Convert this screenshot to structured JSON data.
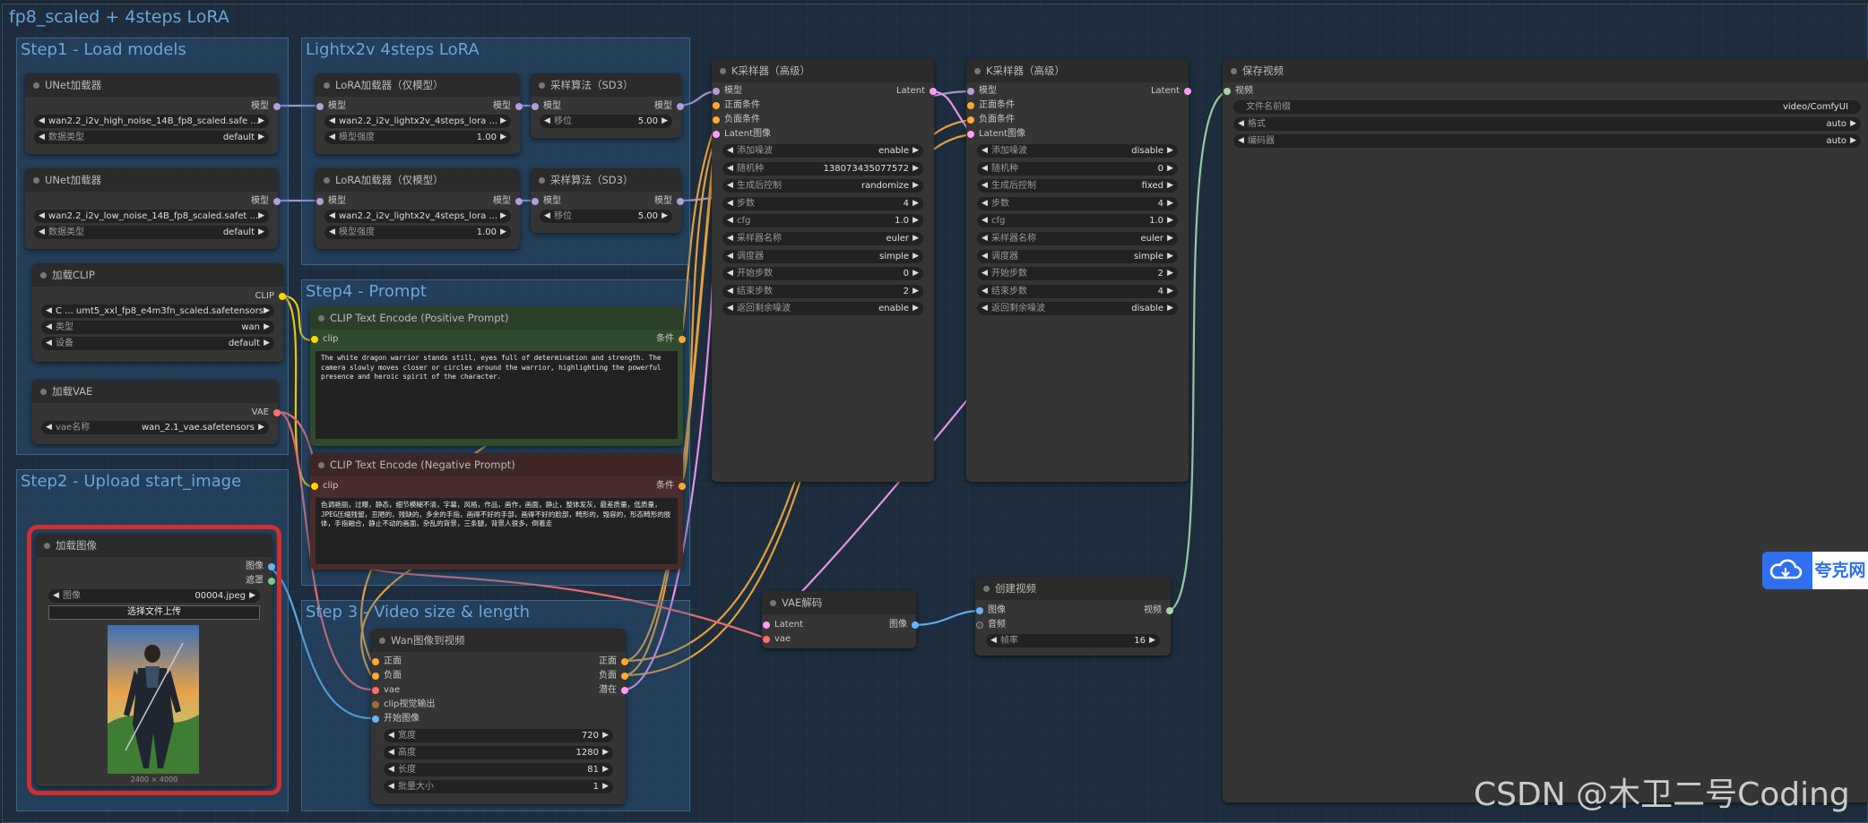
{
  "workflow_title": "fp8_scaled +  4steps LoRA",
  "groups": {
    "step1": "Step1 - Load models",
    "lightx": "Lightx2v 4steps LoRA",
    "step2": "Step2 - Upload start_image",
    "step4": "Step4 -  Prompt",
    "step3": "Step 3 - Video size & length"
  },
  "unet1": {
    "title": "UNet加载器",
    "out": "模型",
    "file": "wan2.2_i2v_high_noise_14B_fp8_scaled.safe ...",
    "dtype_label": "数据类型",
    "dtype": "default"
  },
  "unet2": {
    "title": "UNet加载器",
    "out": "模型",
    "file": "wan2.2_i2v_low_noise_14B_fp8_scaled.safet ...",
    "dtype_label": "数据类型",
    "dtype": "default"
  },
  "clip": {
    "title": "加载CLIP",
    "out": "CLIP",
    "file": "C ... umt5_xxl_fp8_e4m3fn_scaled.safetensors",
    "type_label": "类型",
    "type": "wan",
    "device_label": "设备",
    "device": "default"
  },
  "vae": {
    "title": "加载VAE",
    "out": "VAE",
    "name_label": "vae名称",
    "name": "wan_2.1_vae.safetensors"
  },
  "lora1": {
    "title": "LoRA加载器（仅模型）",
    "in": "模型",
    "out": "模型",
    "file": "wan2.2_i2v_lightx2v_4steps_lora ...",
    "strength_label": "模型强度",
    "strength": "1.00"
  },
  "lora2": {
    "title": "LoRA加载器（仅模型）",
    "in": "模型",
    "out": "模型",
    "file": "wan2.2_i2v_lightx2v_4steps_lora ...",
    "strength_label": "模型强度",
    "strength": "1.00"
  },
  "sampling1": {
    "title": "采样算法（SD3）",
    "in": "模型",
    "out": "模型",
    "shift_label": "移位",
    "shift": "5.00"
  },
  "sampling2": {
    "title": "采样算法（SD3）",
    "in": "模型",
    "out": "模型",
    "shift_label": "移位",
    "shift": "5.00"
  },
  "pos_prompt": {
    "title": "CLIP Text Encode (Positive Prompt)",
    "in": "clip",
    "out": "条件",
    "text": "The white dragon warrior stands still, eyes full of determination and strength. The camera slowly moves closer or circles around the warrior, highlighting the powerful presence and heroic spirit of the character."
  },
  "neg_prompt": {
    "title": "CLIP Text Encode (Negative Prompt)",
    "in": "clip",
    "out": "条件",
    "text": "色调艳丽，过曝，静态，细节模糊不清，字幕，风格，作品，画作，画面，静止，整体发灰，最差质量，低质量，JPEG压缩残留，丑陋的，残缺的，多余的手指，画得不好的手部，画得不好的脸部，畸形的，毁容的，形态畸形的肢体，手指融合，静止不动的画面，杂乱的背景，三条腿，背景人很多，倒着走"
  },
  "load_image": {
    "title": "加载图像",
    "out_image": "图像",
    "out_mask": "遮罩",
    "image_label": "图像",
    "image": "00004.jpeg",
    "upload": "选择文件上传",
    "dims": "2400 × 4000"
  },
  "wan_i2v": {
    "title": "Wan图像到视频",
    "in_pos": "正面",
    "in_neg": "负面",
    "in_vae": "vae",
    "in_clip": "clip视觉输出",
    "in_start": "开始图像",
    "out_pos": "正面",
    "out_neg": "负面",
    "out_latent": "潜在",
    "width_label": "宽度",
    "width": "720",
    "height_label": "高度",
    "height": "1280",
    "length_label": "长度",
    "length": "81",
    "batch_label": "批量大小",
    "batch": "1"
  },
  "ksampler1": {
    "title": "K采样器（高级）",
    "in_model": "模型",
    "in_pos": "正面条件",
    "in_neg": "负面条件",
    "in_latent": "Latent图像",
    "out": "Latent",
    "rows": [
      {
        "label": "添加噪波",
        "value": "enable"
      },
      {
        "label": "随机种",
        "value": "138073435077572"
      },
      {
        "label": "生成后控制",
        "value": "randomize"
      },
      {
        "label": "步数",
        "value": "4"
      },
      {
        "label": "cfg",
        "value": "1.0"
      },
      {
        "label": "采样器名称",
        "value": "euler"
      },
      {
        "label": "调度器",
        "value": "simple"
      },
      {
        "label": "开始步数",
        "value": "0"
      },
      {
        "label": "结束步数",
        "value": "2"
      },
      {
        "label": "返回剩余噪波",
        "value": "enable"
      }
    ]
  },
  "ksampler2": {
    "title": "K采样器（高级）",
    "in_model": "模型",
    "in_pos": "正面条件",
    "in_neg": "负面条件",
    "in_latent": "Latent图像",
    "out": "Latent",
    "rows": [
      {
        "label": "添加噪波",
        "value": "disable"
      },
      {
        "label": "随机种",
        "value": "0"
      },
      {
        "label": "生成后控制",
        "value": "fixed"
      },
      {
        "label": "步数",
        "value": "4"
      },
      {
        "label": "cfg",
        "value": "1.0"
      },
      {
        "label": "采样器名称",
        "value": "euler"
      },
      {
        "label": "调度器",
        "value": "simple"
      },
      {
        "label": "开始步数",
        "value": "2"
      },
      {
        "label": "结束步数",
        "value": "4"
      },
      {
        "label": "返回剩余噪波",
        "value": "disable"
      }
    ]
  },
  "vae_decode": {
    "title": "VAE解码",
    "in_latent": "Latent",
    "in_vae": "vae",
    "out": "图像"
  },
  "create_video": {
    "title": "创建视频",
    "in_image": "图像",
    "in_audio": "音频",
    "out": "视频",
    "fps_label": "帧率",
    "fps": "16"
  },
  "save_video": {
    "title": "保存视频",
    "in": "视频",
    "prefix_label": "文件名前缀",
    "prefix": "video/ComfyUI",
    "format_label": "格式",
    "format": "auto",
    "codec_label": "编码器",
    "codec": "auto"
  },
  "watermark": "CSDN @木卫二号Coding",
  "quark_label": "夸克网",
  "colors": {
    "model": "#b39ddb",
    "clip": "#ffd500",
    "vae": "#ff6e6e",
    "conditioning": "#ffa931",
    "latent": "#ff9cf9",
    "image": "#64b5f6",
    "mask": "#81c784",
    "video": "#a5d6a7",
    "highlight": "#d32f2f"
  }
}
